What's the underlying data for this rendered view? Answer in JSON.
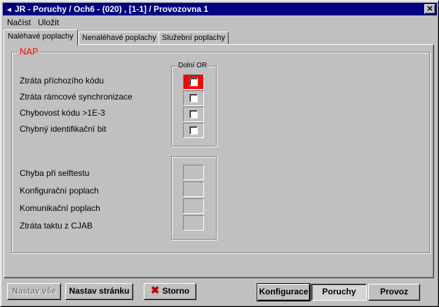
{
  "window": {
    "title": "JR - Poruchy / Och6 - (020) , [1-1] / Provozovna 1",
    "close_glyph": "✕",
    "sys_icon": "◄"
  },
  "menu": {
    "items": [
      "Načíst",
      "Uložit"
    ]
  },
  "tabs": [
    {
      "label": "Naléhavé poplachy",
      "active": true
    },
    {
      "label": "Nenaléhavé poplachy",
      "active": false
    },
    {
      "label": "Služební poplachy",
      "active": false
    }
  ],
  "group": {
    "legend": "NAP",
    "legend_color": "#ff0000",
    "column_header": "Dolní OR",
    "alarms": [
      {
        "label": "Ztráta příchozího kódu",
        "active": true
      },
      {
        "label": "Ztráta rámcové synchronizace",
        "active": false
      },
      {
        "label": "Chybovost kódu >1E-3",
        "active": false
      },
      {
        "label": "Chybný identifikační bit",
        "active": false
      }
    ],
    "status": [
      {
        "label": "Chyba při selftestu"
      },
      {
        "label": "Konfigurační poplach"
      },
      {
        "label": "Komunikační poplach"
      },
      {
        "label": "Ztráta taktu z CJAB"
      }
    ],
    "alarm_color": "#ff0000"
  },
  "buttons": {
    "set_all": "Nastav vše",
    "set_page": "Nastav stránku",
    "cancel": "Storno",
    "cancel_icon": "✖",
    "config": "Konfigurace",
    "faults": "Poruchy",
    "operation": "Provoz"
  }
}
